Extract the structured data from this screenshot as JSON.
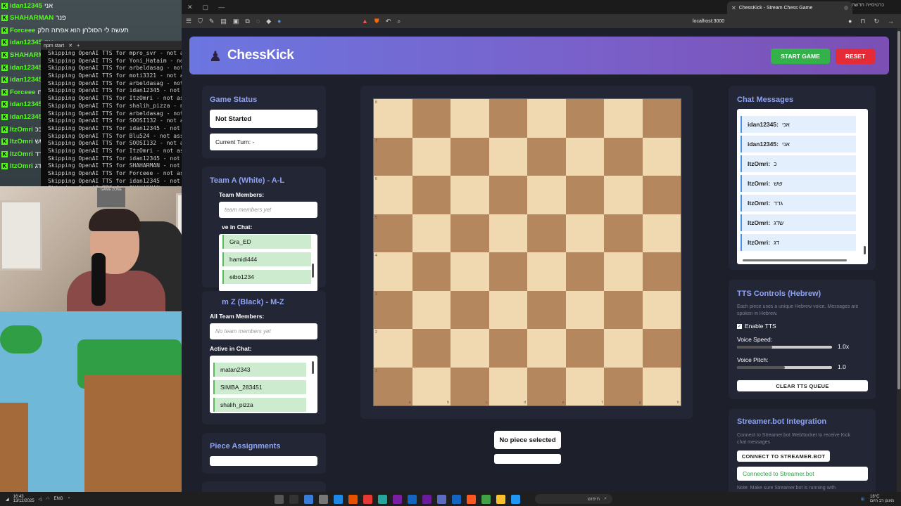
{
  "overlay": {
    "chat": [
      {
        "user": "idan12345",
        "msg": "אני"
      },
      {
        "user": "SHAHARMAN",
        "msg": "פנר"
      },
      {
        "user": "Forceee",
        "msg": "תעשה לי הסולחן הוא אפתה חלק"
      },
      {
        "user": "idan12345",
        "msg": "אני"
      },
      {
        "user": "SHAHARMAN",
        "msg": "מריא"
      },
      {
        "user": "idan12345",
        "msg": "אני"
      },
      {
        "user": "idan12345",
        "msg": "אני"
      },
      {
        "user": "Forceee",
        "msg": "אני כוח"
      },
      {
        "user": "idan12345",
        "msg": "אני"
      },
      {
        "user": "idan12345",
        "msg": "אני"
      },
      {
        "user": "ItzOmri",
        "msg": "ככ"
      },
      {
        "user": "ItzOmri",
        "msg": "שש"
      },
      {
        "user": "ItzOmri",
        "msg": "גדד"
      },
      {
        "user": "ItzOmri",
        "msg": "דג"
      }
    ],
    "terminal_tab": "npm start",
    "terminal_lines": [
      "Skipping OpenAI TTS for mpro_svr - not ass",
      "Skipping OpenAI TTS for Yoni_Hataim - not",
      "Skipping OpenAI TTS for arbeldasag - not a",
      "Skipping OpenAI TTS for moti3321 - not ass",
      "Skipping OpenAI TTS for arbeldasag - not a",
      "Skipping OpenAI TTS for idan12345 - not as",
      "Skipping OpenAI TTS for ItzOmri - not assi",
      "Skipping OpenAI TTS for shalih_pizza - not",
      "Skipping OpenAI TTS for arbeldasag - not a",
      "Skipping OpenAI TTS for SOOSI132 - not ass",
      "Skipping OpenAI TTS for idan12345 - not as",
      "Skipping OpenAI TTS for Blu524 - not assig",
      "Skipping OpenAI TTS for SOOSI132 - not ass",
      "Skipping OpenAI TTS for ItzOmri - not assi",
      "Skipping OpenAI TTS for idan12345 - not as",
      "Skipping OpenAI TTS for SHAHARMAN - not as",
      "Skipping OpenAI TTS for Forceee - not assi",
      "Skipping OpenAI TTS for idan12345 - not as",
      "Skipping OpenAI TTS for SHAHARMAN - not as",
      "Skipping OpenAI TTS for idan12345 - not as"
    ],
    "cam_sign": "GAME ZONE"
  },
  "browser": {
    "tab_title": "ChessKick - Stream Chess Game",
    "new_tab_label": "כרטיסייה חדשה",
    "url": "localhost:3000"
  },
  "app": {
    "title": "ChessKick",
    "logo_icon": "♟",
    "start_label": "START GAME",
    "reset_label": "RESET"
  },
  "game_status": {
    "title": "Game Status",
    "status": "Not Started",
    "turn": "Current Turn: -"
  },
  "team_a": {
    "title": "Team A (White) - A-L",
    "members_label": "Team Members:",
    "members_placeholder": "team members yet",
    "active_label": "ve in Chat:",
    "active": [
      "Gra_ED",
      "hamidi444",
      "eibo1234"
    ]
  },
  "team_z": {
    "title": "m Z (Black) - M-Z",
    "members_label": "All Team Members:",
    "members_placeholder": "No team members yet",
    "active_label": "Active in Chat:",
    "active": [
      "matan2343",
      "SIMBA_283451",
      "shalih_pizza"
    ]
  },
  "piece_assignments": {
    "title": "Piece Assignments"
  },
  "board": {
    "ranks": [
      "8",
      "7",
      "6",
      "5",
      "4",
      "3",
      "2",
      "1"
    ],
    "files": [
      "a",
      "b",
      "c",
      "d",
      "e",
      "f",
      "g",
      "h"
    ]
  },
  "selection": {
    "text": "No piece selected"
  },
  "chat": {
    "title": "Chat Messages",
    "messages": [
      {
        "user": "idan12345:",
        "msg": "אני"
      },
      {
        "user": "idan12345:",
        "msg": "אני"
      },
      {
        "user": "ItzOmri:",
        "msg": "כ"
      },
      {
        "user": "ItzOmri:",
        "msg": "שש"
      },
      {
        "user": "ItzOmri:",
        "msg": "גדד"
      },
      {
        "user": "ItzOmri:",
        "msg": "שדג"
      },
      {
        "user": "ItzOmri:",
        "msg": "דג"
      }
    ]
  },
  "tts": {
    "title": "TTS Controls (Hebrew)",
    "desc_line1": "Each piece uses a unique Hebrew voice. Messages are",
    "desc_line2": "spoken in Hebrew.",
    "enable_label": "Enable TTS",
    "speed_label": "Voice Speed:",
    "speed_value": "1.0x",
    "speed_fraction": 0.37,
    "pitch_label": "Voice Pitch:",
    "pitch_value": "1.0",
    "pitch_fraction": 0.5,
    "clear_label": "CLEAR TTS QUEUE"
  },
  "streamerbot": {
    "title": "Streamer.bot Integration",
    "desc_line1": "Connect to Streamer.bot WebSocket to receive Kick",
    "desc_line2": "chat messages",
    "connect_label": "CONNECT TO STREAMER.BOT",
    "status": "Connected to Streamer.bot",
    "note": "Note: Make sure Streamer.bot is running with"
  },
  "taskbar": {
    "time": "16:43",
    "date": "13/12/2025",
    "lang": "ENG",
    "search": "חיפוש",
    "weather": "18°C",
    "weather_desc": "מעונן רב היום"
  },
  "colors": {
    "accent": "#8ea2f5",
    "start": "#33b24a",
    "reset": "#e52b35",
    "light_square": "#f0d8b0",
    "dark_square": "#b4875e",
    "kick_green": "#53fc18"
  }
}
